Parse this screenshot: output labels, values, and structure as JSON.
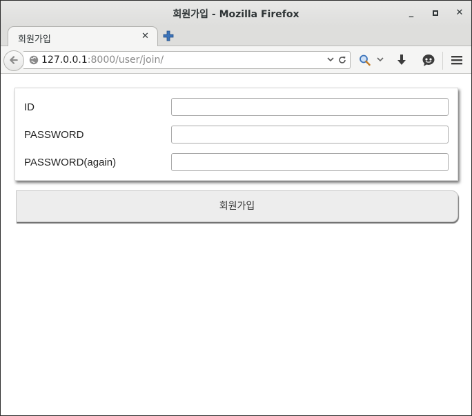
{
  "window": {
    "title": "회원가입 - Mozilla Firefox",
    "minimize_glyph": "_",
    "close_glyph": "✕"
  },
  "tab": {
    "label": "회원가입",
    "close_glyph": "✕"
  },
  "navbar": {
    "url_host": "127.0.0.1",
    "url_rest": ":8000/user/join/"
  },
  "form": {
    "fields": [
      {
        "label": "ID",
        "value": "",
        "type": "text"
      },
      {
        "label": "PASSWORD",
        "value": "",
        "type": "password"
      },
      {
        "label": "PASSWORD(again)",
        "value": "",
        "type": "password"
      }
    ],
    "submit_label": "회원가입"
  },
  "icons": {
    "back": "back-arrow-icon",
    "globe": "globe-icon",
    "reload": "reload-icon",
    "search": "search-icon",
    "download": "download-icon",
    "chat": "chat-icon",
    "menu": "hamburger-menu-icon",
    "new_tab": "plus-icon"
  },
  "colors": {
    "accent_blue": "#3b73b9",
    "button_bg": "#ededed"
  }
}
